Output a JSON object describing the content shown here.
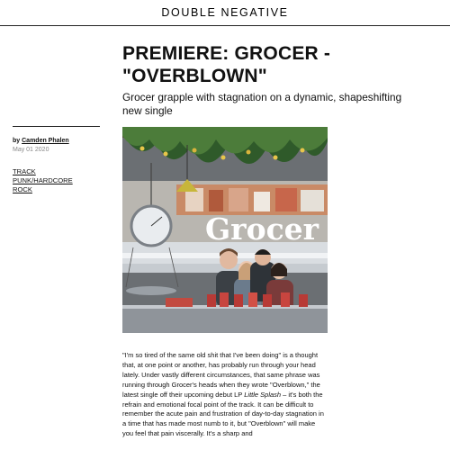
{
  "site": {
    "name": "DOUBLE NEGATIVE"
  },
  "article": {
    "title": "PREMIERE: GROCER - \"OVERBLOWN\"",
    "dek": "Grocer grapple with stagnation on a dynamic, shapeshifting new single",
    "byline_prefix": "by",
    "author": "Camden Phalen",
    "date": "May 01 2020",
    "tags": [
      "TRACK",
      "PUNK/HARDCORE",
      "ROCK"
    ],
    "hero_text": "Grocer",
    "body": {
      "p1": "\"I'm so tired of the same old shit that I've been doing\" is a thought that, at one point or another, has probably run through your head lately. Under vastly different circumstances, that same phrase was running through Grocer's heads when they wrote \"Overblown,\" the latest single off their upcoming debut LP ",
      "album": "Little Splash",
      "p2": " – it's both the refrain and emotional focal point of the track. It can be difficult to remember the acute pain and frustration of day-to-day stagnation in a time that has made most numb to it, but \"Overblown\" will make you feel that pain viscerally. It's a sharp and"
    }
  }
}
